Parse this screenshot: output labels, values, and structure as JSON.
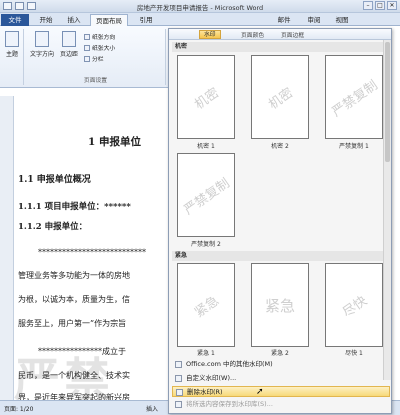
{
  "window": {
    "title": "房地产开发项目申请报告 - Microsoft Word",
    "min": "–",
    "max": "□",
    "close": "✕"
  },
  "tabs": {
    "file": "文件",
    "start": "开始",
    "insert": "插入",
    "page_layout": "页面布局",
    "references": "引用",
    "mailings": "邮件",
    "review": "审阅",
    "view": "视图"
  },
  "ribbon": {
    "theme": "主题",
    "text_direction": "文字方向",
    "margins": "页边距",
    "orientation": "纸张方向",
    "size": "纸张大小",
    "columns": "分栏",
    "page_setup": "页面设置"
  },
  "document": {
    "heading1": "1    申报单位",
    "heading2": "1.1   申报单位概况",
    "heading3a": "1.1.1 项目申报单位：******",
    "heading3b": "1.1.2 申报单位：",
    "line1": "***************************",
    "line2": "管理业务等多功能为一体的房地",
    "line3": "为根，以诚为本，质量为生，信",
    "line4": "服务至上，用户第一”作为宗旨",
    "line5": "****************成立于",
    "line6": "民币，是一个机构健全、技术实",
    "line7": "界，是近年来异军突起的新兴房",
    "bg_watermark": "严禁"
  },
  "status": {
    "page": "页面: 1/20",
    "insert": "插入"
  },
  "watermark_menu": {
    "button": "水印",
    "page_color": "页面颜色",
    "page_border": "页面边框",
    "section_confidential": "机密",
    "section_urgent": "紧急",
    "thumbs": [
      {
        "text": "机密",
        "label": "机密 1",
        "style": "diag"
      },
      {
        "text": "机密",
        "label": "机密 2",
        "style": "diag"
      },
      {
        "text": "严禁复制",
        "label": "严禁复制 1",
        "style": "diag"
      },
      {
        "text": "严禁复制",
        "label": "严禁复制 2",
        "style": "diag"
      },
      {
        "text": "紧急",
        "label": "紧急 1",
        "style": "diag"
      },
      {
        "text": "紧急",
        "label": "紧急 2",
        "style": "horiz"
      },
      {
        "text": "尽快",
        "label": "尽快 1",
        "style": "diag"
      }
    ],
    "items": {
      "office_more": "Office.com 中的其他水印(M)",
      "custom": "自定义水印(W)...",
      "remove": "删除水印(R)",
      "save_selection": "将所选内容保存到水印库(S)..."
    }
  }
}
